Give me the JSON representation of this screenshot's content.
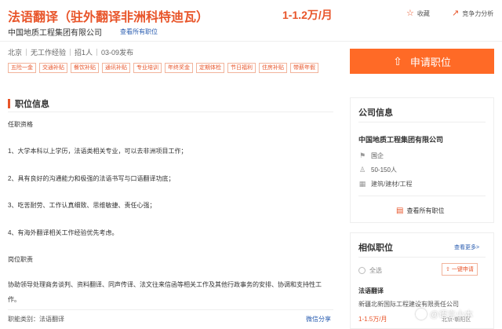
{
  "header": {
    "job_title": "法语翻译（驻外翻译非洲科特迪瓦）",
    "salary": "1-1.2万/月",
    "favorite_label": "收藏",
    "compete_label": "竞争力分析",
    "company": "中国地质工程集团有限公司",
    "view_all_jobs": "查看所有职位"
  },
  "meta": {
    "city": "北京",
    "experience": "无工作经验",
    "headcount": "招1人",
    "date": "03-09发布"
  },
  "tags": [
    "五险一金",
    "交通补贴",
    "餐饮补贴",
    "通讯补贴",
    "专业培训",
    "年终奖金",
    "定期体检",
    "节日福利",
    "住房补贴",
    "带薪年假"
  ],
  "apply_button": "申请职位",
  "job_info": {
    "section_title": "职位信息",
    "lines": [
      "任职资格",
      "1、大学本科以上学历，法语类相关专业，可以去非洲项目工作；",
      "2、具有良好的沟通能力和极强的法语书写与口语翻译功底；",
      "3、吃苦耐劳、工作认真细致、思维敏捷、责任心强；",
      "4、有海外翻译相关工作经验优先考虑。",
      "岗位职责",
      "协助领导处理商务谈判、资料翻译、同声传译、法文往来信函等相关工作及其他行政事务的安排、协调和支持性工作。"
    ],
    "category": "职能类别：法语翻译",
    "share": "微信分享"
  },
  "company_card": {
    "title": "公司信息",
    "name": "中国地质工程集团有限公司",
    "type": "国企",
    "size": "50-150人",
    "industry": "建筑/建材/工程",
    "view_all": "查看所有职位"
  },
  "similar": {
    "title": "相似职位",
    "see_more": "查看更多>",
    "select_all": "全选",
    "one_click": "一键申请",
    "job_title": "法语翻译",
    "company": "新疆北新国际工程建设有限责任公司",
    "salary": "1-1.5万/月",
    "location": "北京-朝阳区"
  },
  "watermark": "@语言小本"
}
